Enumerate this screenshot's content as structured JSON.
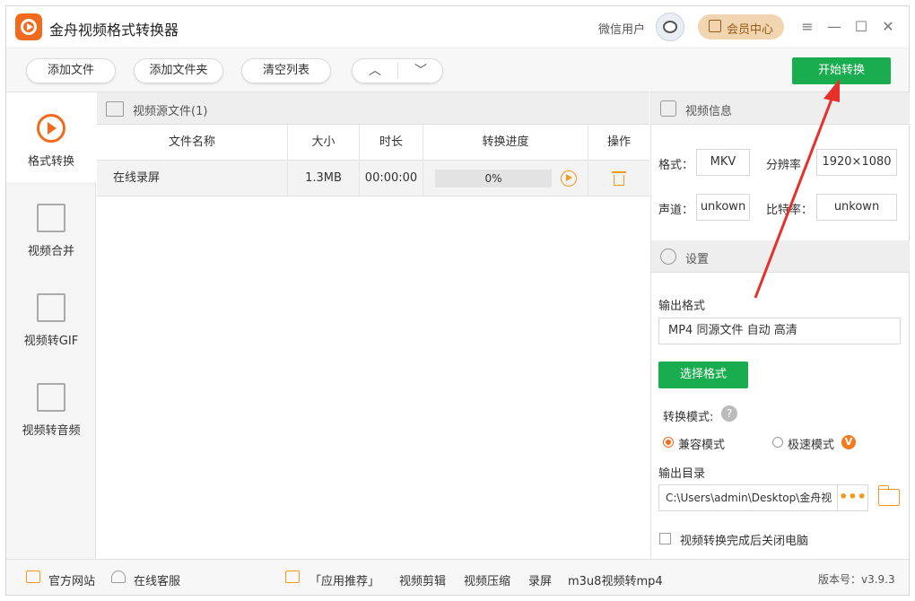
{
  "app": {
    "title": "金舟视频格式转换器"
  },
  "header": {
    "user_label": "微信用户",
    "vip_label": "会员中心"
  },
  "window_controls": {
    "menu": "≡",
    "minimize": "—",
    "maximize": "☐",
    "close": "✕"
  },
  "toolbar": {
    "add_file": "添加文件",
    "add_folder": "添加文件夹",
    "clear_list": "清空列表",
    "up": "︿",
    "down": "﹀",
    "start": "开始转换"
  },
  "sidebar": {
    "items": [
      {
        "label": "格式转换",
        "icon": "convert-icon",
        "active": true
      },
      {
        "label": "视频合并",
        "icon": "merge-icon",
        "active": false
      },
      {
        "label": "视频转GIF",
        "icon": "gif-icon",
        "active": false
      },
      {
        "label": "视频转音频",
        "icon": "audio-icon",
        "active": false
      }
    ]
  },
  "source": {
    "title": "视频源文件(1)",
    "columns": [
      "文件名称",
      "大小",
      "时长",
      "转换进度",
      "操作"
    ],
    "rows": [
      {
        "name": "在线录屏",
        "size": "1.3MB",
        "duration": "00:00:00",
        "progress": "0%"
      }
    ]
  },
  "video_info": {
    "title": "视频信息",
    "format_label": "格式：",
    "format_value": "MKV",
    "resolution_label": "分辨率",
    "resolution_value": "1920×1080",
    "channel_label": "声道：",
    "channel_value": "unkown",
    "bitrate_label": "比特率：",
    "bitrate_value": "unkown"
  },
  "settings": {
    "title": "设置",
    "output_format_label": "输出格式",
    "output_format_value": "MP4 同源文件 自动 高清",
    "select_format_button": "选择格式",
    "mode_label": "转换模式:",
    "help": "?",
    "mode_compatible": "兼容模式",
    "mode_fast": "极速模式",
    "vip_badge": "V",
    "output_dir_label": "输出目录",
    "output_dir_value": "C:\\Users\\admin\\Desktop\\金舟视",
    "dots": "•••",
    "shutdown_label": "视频转换完成后关闭电脑"
  },
  "bottom": {
    "website": "官方网站",
    "service": "在线客服",
    "recommend": "「应用推荐」",
    "links": [
      "视频剪辑",
      "视频压缩",
      "录屏",
      "m3u8视频转mp4"
    ],
    "version": "版本号：v3.9.3"
  },
  "colors": {
    "accent_orange": "#f26b1d",
    "green": "#1aad4f",
    "annotation_red": "#e8302a"
  }
}
